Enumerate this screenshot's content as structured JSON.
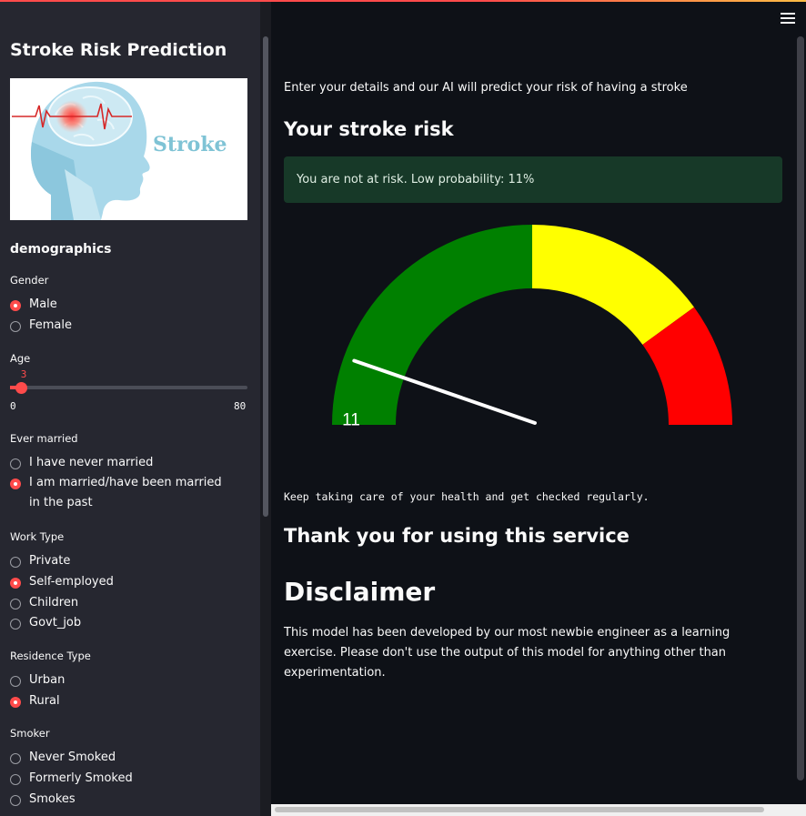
{
  "sidebar": {
    "title": "Stroke Risk Prediction",
    "hero_word": "Stroke",
    "section_title": "demographics",
    "gender": {
      "label": "Gender",
      "options": [
        "Male",
        "Female"
      ],
      "selected": "Male"
    },
    "age": {
      "label": "Age",
      "value": "3",
      "min": "0",
      "max": "80",
      "fraction": 0.0375
    },
    "ever_married": {
      "label": "Ever married",
      "options": [
        "I have never married",
        "I am married/have been married in the past"
      ],
      "selected": "I am married/have been married in the past"
    },
    "work_type": {
      "label": "Work Type",
      "options": [
        "Private",
        "Self-employed",
        "Children",
        "Govt_job"
      ],
      "selected": "Self-employed"
    },
    "residence": {
      "label": "Residence Type",
      "options": [
        "Urban",
        "Rural"
      ],
      "selected": "Rural"
    },
    "smoker": {
      "label": "Smoker",
      "options": [
        "Never Smoked",
        "Formerly Smoked",
        "Smokes"
      ],
      "selected": ""
    }
  },
  "main": {
    "intro": "Enter your details and our AI will predict your risk of having a stroke",
    "risk_heading": "Your stroke risk",
    "alert": "You are not at risk. Low probability: 11%",
    "gauge": {
      "value": 11,
      "label": "11",
      "min": 0,
      "max": 100,
      "bands": [
        {
          "from": 0,
          "to": 50,
          "color": "#008000"
        },
        {
          "from": 50,
          "to": 80,
          "color": "#ffff00"
        },
        {
          "from": 80,
          "to": 100,
          "color": "#ff0000"
        }
      ]
    },
    "advice": "Keep taking care of your health and get checked regularly.",
    "thanks": "Thank you for using this service",
    "disclaimer_title": "Disclaimer",
    "disclaimer_text": "This model has been developed by our most newbie engineer as a learning exercise. Please don't use the output of this model for anything other than experimentation."
  },
  "colors": {
    "accent": "#ff4b4b",
    "alert_bg": "#173928",
    "sidebar_bg": "#262730",
    "main_bg": "#0e1117"
  },
  "icons": {
    "menu": "hamburger-menu-icon"
  }
}
